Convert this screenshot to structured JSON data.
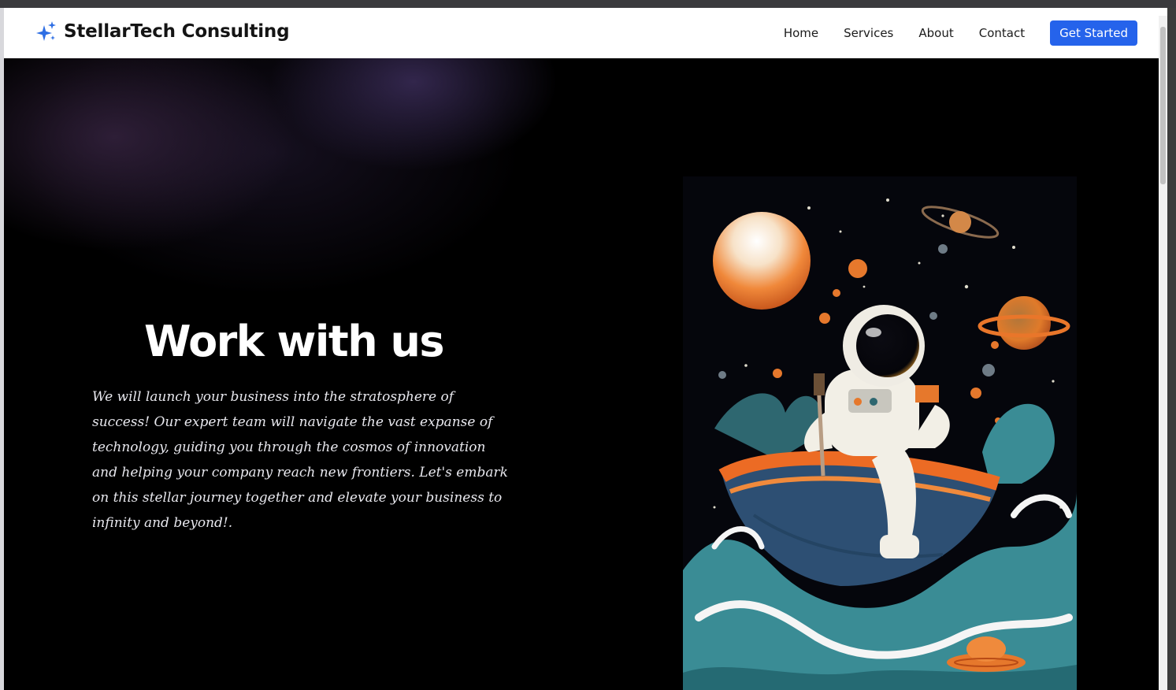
{
  "brand": {
    "name": "StellarTech Consulting",
    "icon": "sparkles-icon",
    "icon_color": "#2f6fe4"
  },
  "nav": {
    "items": [
      {
        "label": "Home"
      },
      {
        "label": "Services"
      },
      {
        "label": "About"
      },
      {
        "label": "Contact"
      }
    ],
    "cta_label": "Get Started",
    "cta_color": "#2563eb"
  },
  "hero": {
    "title": "Work with us",
    "description": "We will launch your business into the stratosphere of success! Our expert team will navigate the vast expanse of technology, guiding you through the cosmos of innovation and helping your company reach new frontiers. Let's embark on this stellar journey together and elevate your business to infinity and beyond!.",
    "background_color": "#000000",
    "illustration": "astronaut-in-boat-illustration"
  }
}
